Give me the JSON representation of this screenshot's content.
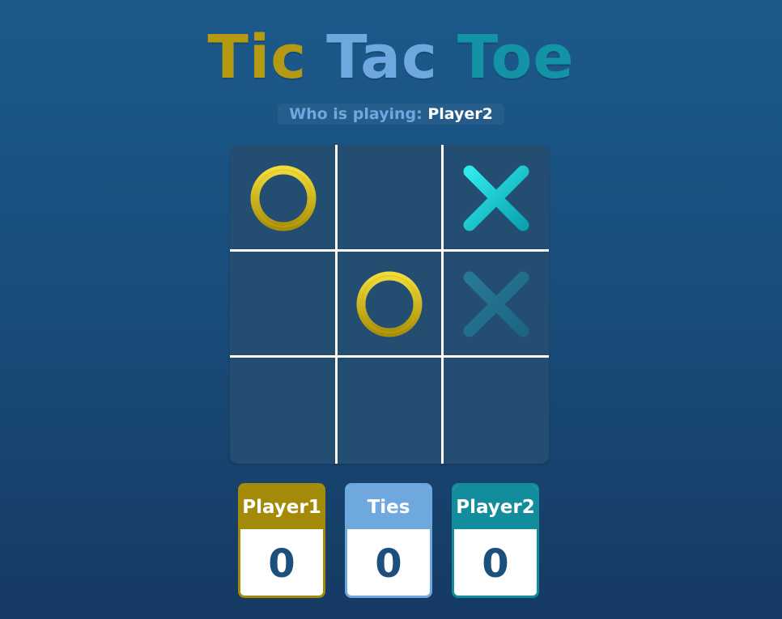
{
  "title": {
    "words": [
      "Tic",
      "Tac",
      "Toe"
    ],
    "colors": [
      "#b39a12",
      "#6fa8df",
      "#1493a6"
    ]
  },
  "turn": {
    "label": "Who is playing:",
    "player": "Player2",
    "label_color": "#6fa8df",
    "player_color": "#ffffff"
  },
  "board": {
    "cells": [
      "O",
      "",
      "X",
      "",
      "O",
      "X",
      "",
      "",
      ""
    ],
    "preview_cell": 5,
    "o_color": "#d2b515",
    "x_color": "#12c4cc"
  },
  "scores": {
    "player1": {
      "label": "Player1",
      "value": "0",
      "color": "#a48a09"
    },
    "ties": {
      "label": "Ties",
      "value": "0",
      "color": "#6fa8df"
    },
    "player2": {
      "label": "Player2",
      "value": "0",
      "color": "#138c9c"
    }
  }
}
